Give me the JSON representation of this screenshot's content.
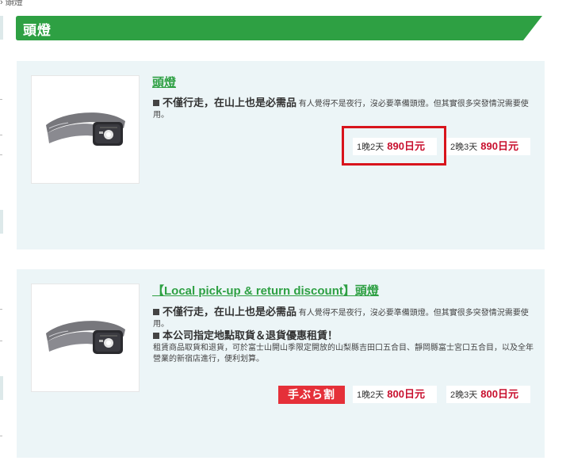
{
  "breadcrumb": {
    "current": "頭燈"
  },
  "section": {
    "title": "頭燈",
    "color": "#2ea043"
  },
  "products": [
    {
      "title": "頭燈",
      "tagline": "不僅行走，在山上也是必需品",
      "description": "有人覺得不是夜行，沒必要準備頭燈。但其實很多突發情況需要使用。",
      "prices": [
        {
          "label": "1晚2天",
          "amount": "890日元"
        },
        {
          "label": "2晚3天",
          "amount": "890日元"
        }
      ]
    },
    {
      "title": "【Local pick-up & return discount】頭燈",
      "tagline": "不僅行走，在山上也是必需品",
      "description": "有人覺得不是夜行，沒必要準備頭燈。但其實很多突發情況需要使用。",
      "notice_head": "本公司指定地點取貨＆退貨優惠租賃！",
      "notice_body": "租賃商品取貨和退貨，可於富士山開山季限定開放的山梨縣吉田口五合目、靜岡縣富士宮口五合目，以及全年營業的新宿店進行，便利划算。",
      "badge": "手ぶら割",
      "prices": [
        {
          "label": "1晚2天",
          "amount": "800日元"
        },
        {
          "label": "2晚3天",
          "amount": "800日元"
        }
      ]
    }
  ],
  "colors": {
    "price": "#c8102e",
    "card_bg": "#ecf5f7",
    "highlight": "#d8141c",
    "badge_bg": "#e53039"
  }
}
